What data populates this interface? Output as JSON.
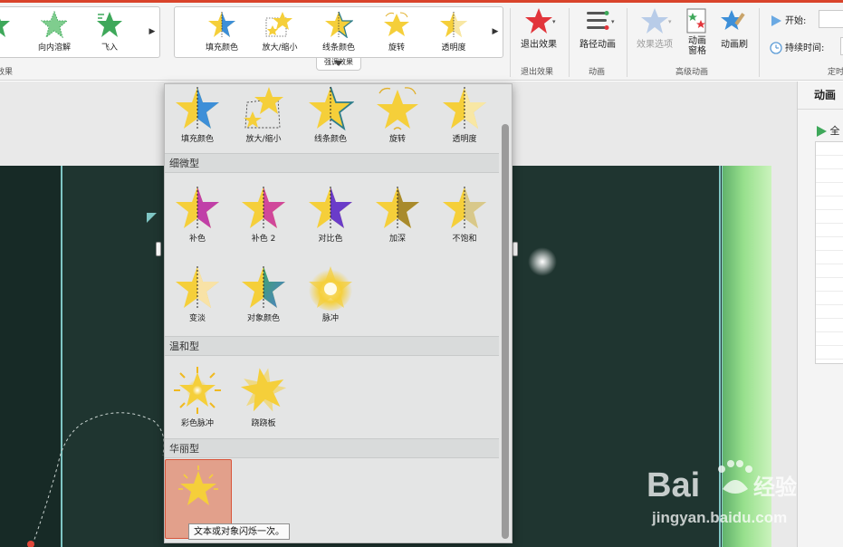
{
  "ribbon": {
    "gallery_left": [
      {
        "label": "",
        "icon": "star-partial-icon"
      },
      {
        "label": "向内溶解",
        "icon": "star-dissolve-icon"
      },
      {
        "label": "飞入",
        "icon": "star-fly-in-icon"
      }
    ],
    "gallery_emphasis": [
      {
        "label": "填充颜色",
        "icon": "star-fill-color-icon"
      },
      {
        "label": "放大/缩小",
        "icon": "star-grow-shrink-icon"
      },
      {
        "label": "线条颜色",
        "icon": "star-line-color-icon"
      },
      {
        "label": "旋转",
        "icon": "star-spin-icon"
      },
      {
        "label": "透明度",
        "icon": "star-transparency-icon"
      }
    ],
    "gallery_tab_label": "强调效果",
    "groups": {
      "entrance_label": "效果",
      "exit_label": "退出效果",
      "animation_label": "动画",
      "advanced_label": "高级动画",
      "timing_label": "定时"
    },
    "buttons": {
      "exit_effect": "退出效果",
      "path_animation": "路径动画",
      "effect_options": "效果选项",
      "animation_pane_line1": "动画",
      "animation_pane_line2": "窗格",
      "animation_painter": "动画刷"
    },
    "timing": {
      "start_label": "开始:",
      "duration_label": "持续时间:"
    }
  },
  "right_pane": {
    "title": "动画",
    "play_label": "全"
  },
  "dropdown": {
    "top_row": [
      {
        "label": "填充颜色",
        "icon": "star-fill-color-icon"
      },
      {
        "label": "放大/缩小",
        "icon": "star-grow-shrink-icon"
      },
      {
        "label": "线条颜色",
        "icon": "star-line-color-icon"
      },
      {
        "label": "旋转",
        "icon": "star-spin-icon"
      },
      {
        "label": "透明度",
        "icon": "star-transparency-icon"
      }
    ],
    "sections": [
      {
        "title": "细微型",
        "items": [
          {
            "label": "补色",
            "icon": "star-complementary-icon"
          },
          {
            "label": "补色 2",
            "icon": "star-complementary-2-icon"
          },
          {
            "label": "对比色",
            "icon": "star-contrast-icon"
          },
          {
            "label": "加深",
            "icon": "star-darken-icon"
          },
          {
            "label": "不饱和",
            "icon": "star-desaturate-icon"
          },
          {
            "label": "变淡",
            "icon": "star-lighten-icon"
          },
          {
            "label": "对象颜色",
            "icon": "star-object-color-icon"
          },
          {
            "label": "脉冲",
            "icon": "star-pulse-icon"
          }
        ]
      },
      {
        "title": "温和型",
        "items": [
          {
            "label": "彩色脉冲",
            "icon": "star-color-pulse-icon"
          },
          {
            "label": "跷跷板",
            "icon": "star-teeter-icon"
          }
        ]
      },
      {
        "title": "华丽型",
        "items": [
          {
            "label": "",
            "icon": "star-flicker-icon"
          }
        ]
      }
    ],
    "tooltip": "文本或对象闪烁一次。"
  },
  "watermark": {
    "text": "jingyan.baidu.com"
  },
  "colors": {
    "star_yellow": "#f5cf3a",
    "accent_red": "#d9442b",
    "slide_dark": "#1f3530"
  }
}
